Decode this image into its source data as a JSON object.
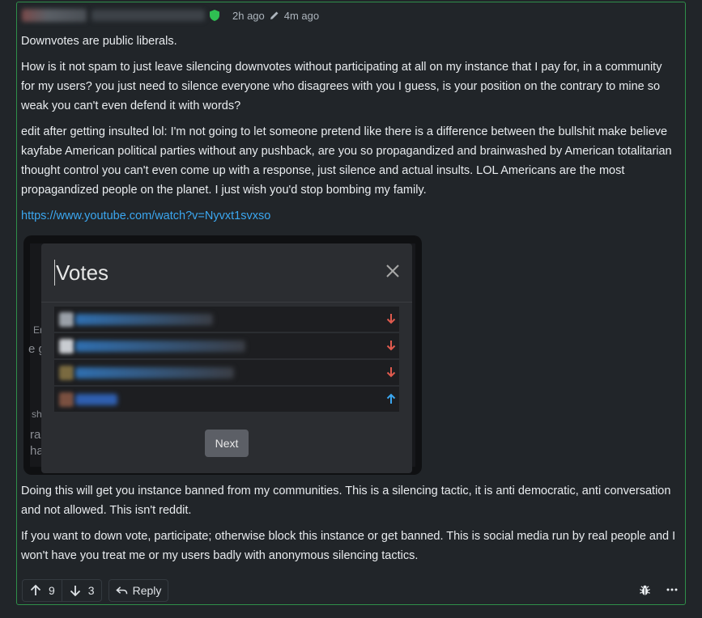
{
  "comment": {
    "post_time": "2h ago",
    "edit_time": "4m ago",
    "paragraphs": [
      "Downvotes are public liberals.",
      "How is it not spam to just leave silencing downvotes without participating at all on my instance that I pay for, in a community for my users? you just need to silence everyone who disagrees with you I guess, is your position on the contrary to mine so weak you can't even defend it with words?",
      "edit after getting insulted lol: I'm not going to let someone pretend like there is a difference between the bullshit make believe kayfabe American political parties without any pushback, are you so propagandized and brainwashed by American totalitarian thought control you can't even come up with a response, just silence and actual insults. LOL Americans are the most propagandized people on the planet. I just wish you'd stop bombing my family."
    ],
    "link": "https://www.youtube.com/watch?v=Nyvxt1svxso",
    "paragraphs_after": [
      "Doing this will get you instance banned from my communities. This is a silencing tactic, it is anti democratic, anti conversation and not allowed. This isn't reddit.",
      "If you want to down vote, participate; otherwise block this instance or get banned. This is social media run by real people and I won't have you treat me or my users badly with anonymous silencing tactics."
    ]
  },
  "embedded_image": {
    "modal_title": "Votes",
    "next_label": "Next",
    "votes": [
      "down",
      "down",
      "down",
      "up"
    ]
  },
  "footer": {
    "upvotes": "9",
    "downvotes": "3",
    "reply_label": "Reply"
  },
  "colors": {
    "accent_border": "#2f8f4a",
    "link": "#3ba7f0",
    "downvote": "#e05a4e",
    "upvote": "#3ba7f0"
  }
}
